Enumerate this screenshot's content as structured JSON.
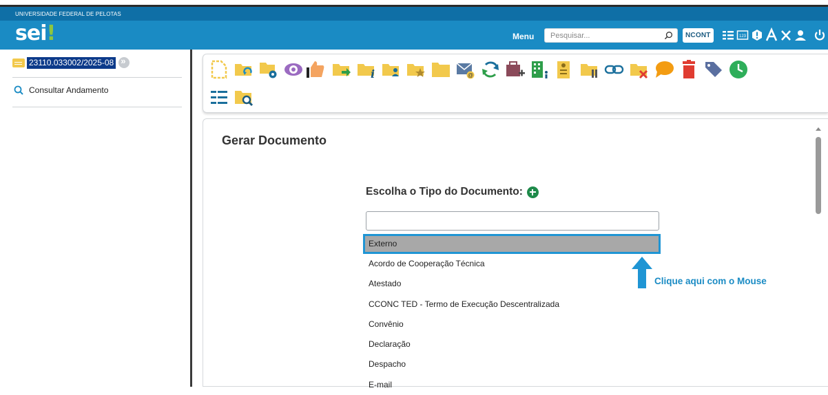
{
  "header": {
    "university": "UNIVERSIDADE FEDERAL DE PELOTAS",
    "logo_text": "sei",
    "logo_mark": "!",
    "menu_label": "Menu",
    "search_placeholder": "Pesquisar...",
    "unit_label": "NCONT",
    "icons": [
      "list-icon",
      "calculator-icon",
      "alert-icon",
      "font-size-icon",
      "tools-icon",
      "user-icon",
      "power-icon"
    ]
  },
  "sidebar": {
    "process_number": "23110.033002/2025-08",
    "consult_label": "Consultar Andamento"
  },
  "toolbar": {
    "icons": [
      "new-document-icon",
      "folder-sync-icon",
      "folder-settings-icon",
      "view-eye-icon",
      "sign-icon",
      "folder-forward-icon",
      "folder-info-icon",
      "folder-user-icon",
      "folder-star-icon",
      "folder-plain-icon",
      "email-icon",
      "refresh-icon",
      "briefcase-add-icon",
      "building-icon",
      "clipboard-user-icon",
      "folder-pause-icon",
      "link-icon",
      "folder-close-icon",
      "comment-icon",
      "trash-icon",
      "tag-icon",
      "clock-icon",
      "list-view-icon",
      "folder-search-icon"
    ]
  },
  "content": {
    "page_title": "Gerar Documento",
    "choose_label": "Escolha o Tipo do Documento:",
    "filter_value": "",
    "document_types": [
      "Externo",
      "Acordo de Cooperação Técnica",
      "Atestado",
      "CCONC TED - Termo de Execução Descentralizada",
      "Convênio",
      "Declaração",
      "Despacho",
      "E-mail"
    ],
    "selected_type": "Externo",
    "callout": "Clique aqui com o Mouse"
  },
  "colors": {
    "header_blue": "#1a8bc4",
    "header_dark": "#0f6fa6",
    "selection_border": "#1f95d4",
    "selection_fill": "#a8a8a8",
    "folder_yellow": "#f2c94c"
  }
}
